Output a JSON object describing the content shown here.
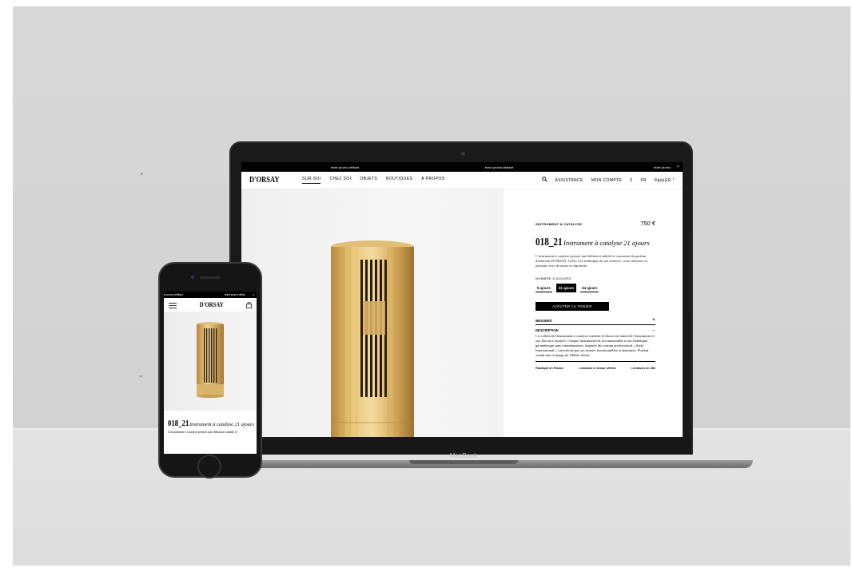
{
  "desktop": {
    "promo": [
      "texte promo défilant",
      "texte promo défilant",
      "texte promo"
    ],
    "logo": "D'ORSAY",
    "nav_left": [
      "SUR SOI",
      "CHEZ SOI",
      "OBJETS",
      "BOUTIQUES",
      "À PROPOS"
    ],
    "nav_right": {
      "assistance": "ASSISTANCE",
      "account": "MON COMPTE",
      "currency": "€",
      "lang": "FR",
      "cart": "PANIER",
      "cart_count": "1"
    },
    "product": {
      "kicker": "INSTRUMENT À CATALYSE",
      "price": "750 €",
      "code": "018_21",
      "name": "Instrument à catalyse 21 ajours",
      "description": "L'instrument à catalyse permet une diffusion subtile et constante du parfum d'intérieur D'ORSAY. Grâce à la technique de son essence, votre intérieur se parfume avec douceur et régularité.",
      "days_label": "NOMBRE D'AJOURS",
      "options": [
        "9 ajours",
        "21 ajours",
        "54 ajours"
      ],
      "selected_option": "21 ajours",
      "add_to_cart": "AJOUTER AU PANIER",
      "accordion_measures": "MESURES",
      "accordion_description": "DESCRIPTION",
      "accordion_body": "Le coffret de l'instrument à catalyse contient le flacon en laiton de l'instrument et son flacon à catalyse. Chaque instrument est reconnaissable à son esthétique géométrique sans ornementation, inspirée du courant architectural « Style International » caractérisé par ses formes fonctionnelles et abstraites. Produit vendu une recharge de 100ml offerte.",
      "footer": [
        "Fabriqué en France",
        "Livraison et retour offerts",
        "Livraison en 48h"
      ]
    }
  },
  "device_label": "MacBook",
  "mobile": {
    "promo": [
      "te promo défilant",
      "texte promo défila"
    ],
    "logo": "D'ORSAY",
    "code": "018_21",
    "name": "Instrument à catalyse 21 ajours",
    "description": "L'instrument à catalyse permet une diffusion subtile et"
  }
}
